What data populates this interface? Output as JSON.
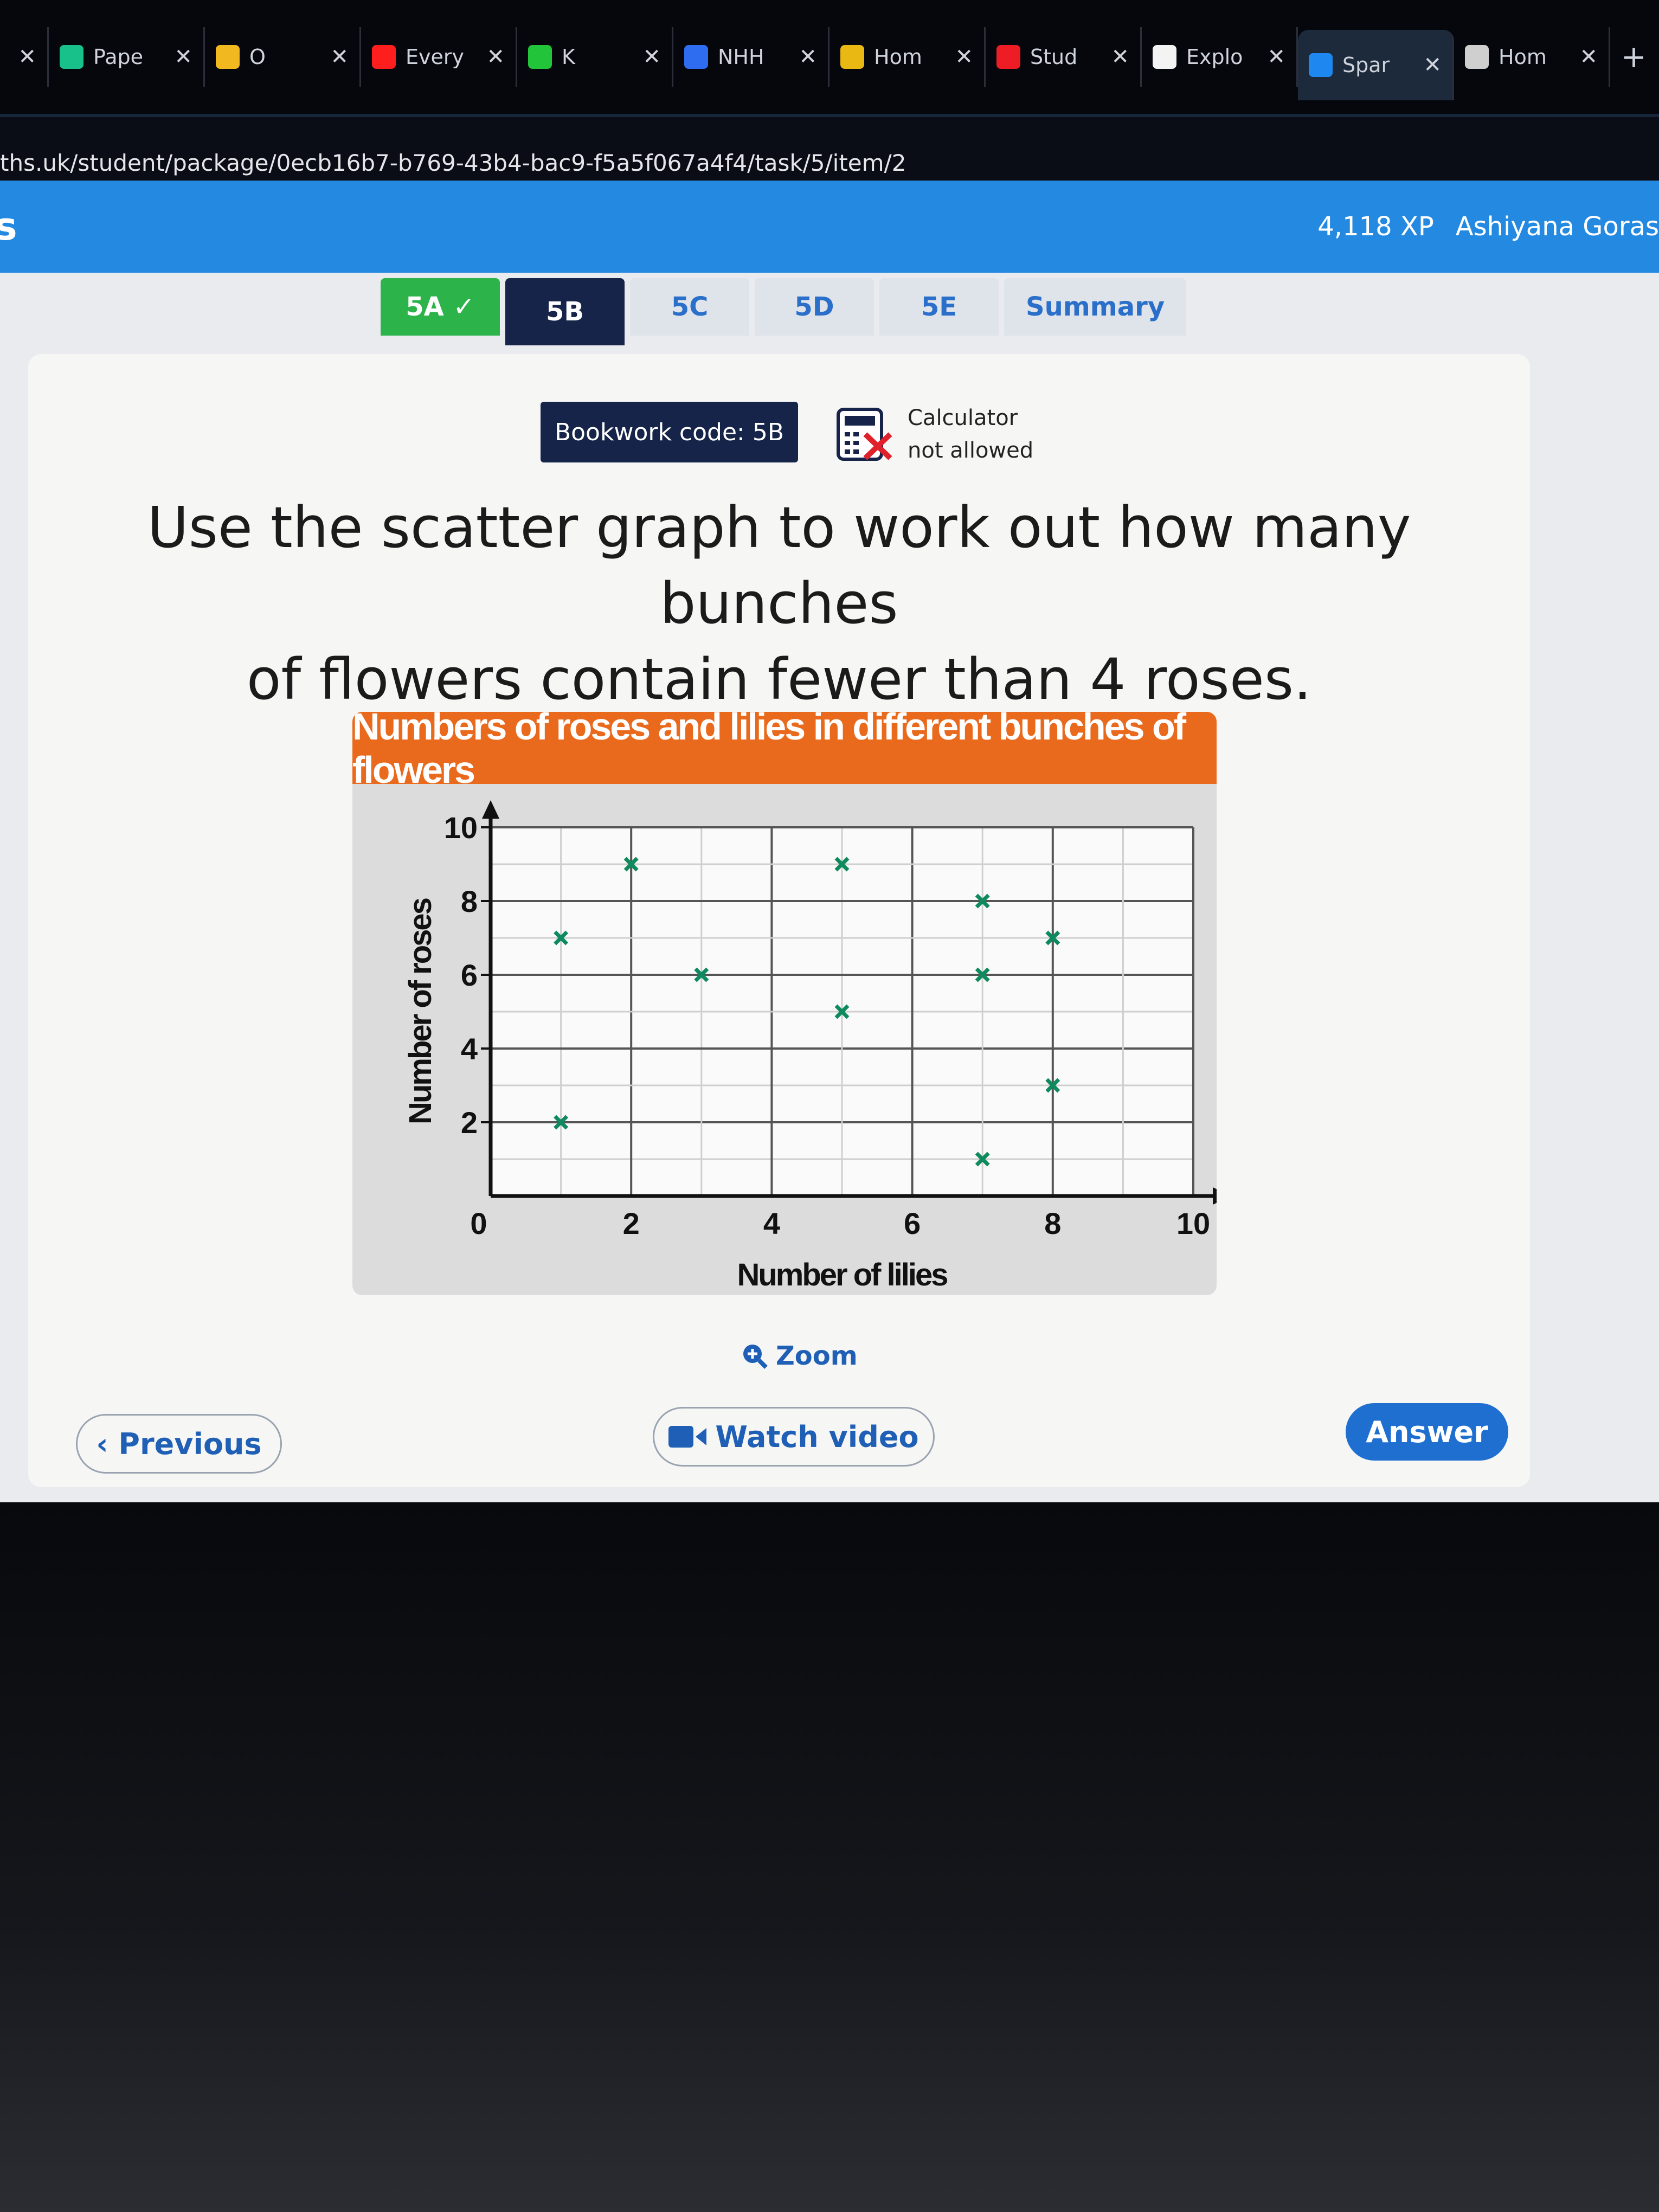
{
  "browser": {
    "tabs": [
      {
        "label": "",
        "color": "#888"
      },
      {
        "label": "Pape",
        "color": "#18c08a"
      },
      {
        "label": "O",
        "color": "#f1b820"
      },
      {
        "label": "Every",
        "color": "#ff1e1e"
      },
      {
        "label": "K",
        "color": "#22c43a"
      },
      {
        "label": "NHH",
        "color": "#2f6df0"
      },
      {
        "label": "Hom",
        "color": "#e9b812"
      },
      {
        "label": "Stud",
        "color": "#ee1c25"
      },
      {
        "label": "Explo",
        "color": "#f3f3f3"
      },
      {
        "label": "Spar",
        "color": "#1e88f0",
        "active": true
      },
      {
        "label": "Hom",
        "color": "#cfcfcf"
      }
    ],
    "url": "ths.uk/student/package/0ecb16b7-b769-43b4-bac9-f5a5f067a4f4/task/5/item/2"
  },
  "header": {
    "brand": "s",
    "xp": "4,118 XP",
    "user": "Ashiyana Goras"
  },
  "section_tabs": [
    {
      "label": "5A ✓",
      "state": "done"
    },
    {
      "label": "5B",
      "state": "current"
    },
    {
      "label": "5C"
    },
    {
      "label": "5D"
    },
    {
      "label": "5E"
    },
    {
      "label": "Summary"
    }
  ],
  "bookwork": "Bookwork code: 5B",
  "calculator": {
    "line1": "Calculator",
    "line2": "not allowed"
  },
  "question": {
    "line1": "Use the scatter graph to work out how many bunches",
    "line2": "of flowers contain fewer than 4 roses."
  },
  "chart_data": {
    "type": "scatter",
    "title": "Numbers of roses and lilies in different bunches of flowers",
    "xlabel": "Number of lilies",
    "ylabel": "Number of roses",
    "xlim": [
      0,
      10
    ],
    "ylim": [
      0,
      10
    ],
    "xticks": [
      "0",
      "2",
      "4",
      "6",
      "8",
      "10"
    ],
    "yticks": [
      "2",
      "4",
      "6",
      "8",
      "10"
    ],
    "grid": true,
    "marker": "x",
    "color": "#0f8a5f",
    "points": [
      [
        1,
        7
      ],
      [
        1,
        2
      ],
      [
        2,
        9
      ],
      [
        3,
        6
      ],
      [
        5,
        9
      ],
      [
        5,
        5
      ],
      [
        7,
        8
      ],
      [
        7,
        6
      ],
      [
        7,
        1
      ],
      [
        8,
        7
      ],
      [
        8,
        3
      ]
    ]
  },
  "actions": {
    "zoom": "Zoom",
    "previous": "Previous",
    "watch_video": "Watch video",
    "answer": "Answer"
  },
  "colors": {
    "header": "#2489e0",
    "navy": "#16244a",
    "orange": "#e96a1d",
    "link": "#1f5fb5"
  }
}
